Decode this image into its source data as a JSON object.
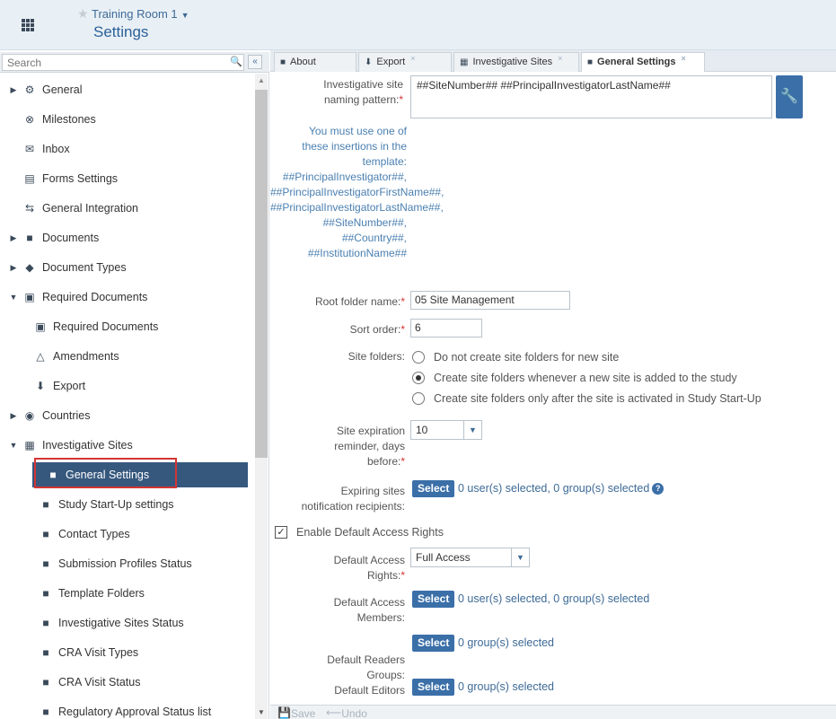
{
  "header": {
    "room_name": "Training Room 1",
    "page_title": "Settings"
  },
  "sidebar": {
    "search_placeholder": "Search",
    "items": [
      {
        "label": "General",
        "icon": "gears-icon",
        "arrow": "▶"
      },
      {
        "label": "Milestones",
        "icon": "milestones-icon",
        "arrow": ""
      },
      {
        "label": "Inbox",
        "icon": "inbox-icon",
        "arrow": ""
      },
      {
        "label": "Forms Settings",
        "icon": "form-icon",
        "arrow": ""
      },
      {
        "label": "General Integration",
        "icon": "integration-icon",
        "arrow": ""
      },
      {
        "label": "Documents",
        "icon": "document-icon",
        "arrow": "▶"
      },
      {
        "label": "Document Types",
        "icon": "tag-icon",
        "arrow": "▶"
      },
      {
        "label": "Required Documents",
        "icon": "clipboard-icon",
        "arrow": "▼"
      },
      {
        "label": "Required Documents",
        "icon": "clipboard-icon",
        "arrow": ""
      },
      {
        "label": "Amendments",
        "icon": "flask-icon",
        "arrow": ""
      },
      {
        "label": "Export",
        "icon": "download-icon",
        "arrow": ""
      },
      {
        "label": "Countries",
        "icon": "globe-icon",
        "arrow": "▶"
      },
      {
        "label": "Investigative Sites",
        "icon": "sites-icon",
        "arrow": "▼"
      },
      {
        "label": "General Settings",
        "icon": "document-icon",
        "arrow": "",
        "selected": true
      },
      {
        "label": "Study Start-Up settings",
        "icon": "document-icon",
        "arrow": ""
      },
      {
        "label": "Contact Types",
        "icon": "document-icon",
        "arrow": ""
      },
      {
        "label": "Submission Profiles Status",
        "icon": "document-icon",
        "arrow": ""
      },
      {
        "label": "Template Folders",
        "icon": "document-icon",
        "arrow": ""
      },
      {
        "label": "Investigative Sites Status",
        "icon": "document-icon",
        "arrow": ""
      },
      {
        "label": "CRA Visit Types",
        "icon": "document-icon",
        "arrow": ""
      },
      {
        "label": "CRA Visit Status",
        "icon": "document-icon",
        "arrow": ""
      },
      {
        "label": "Regulatory Approval Status list",
        "icon": "document-icon",
        "arrow": ""
      }
    ]
  },
  "tabs": [
    {
      "label": "About",
      "icon": "document-icon"
    },
    {
      "label": "Export",
      "icon": "download-icon"
    },
    {
      "label": "Investigative Sites",
      "icon": "sites-icon"
    },
    {
      "label": "General Settings",
      "icon": "document-icon",
      "active": true
    }
  ],
  "form": {
    "naming_pattern_label_1": "Investigative site",
    "naming_pattern_label_2": "naming pattern:",
    "naming_pattern_value": "##SiteNumber## ##PrincipalInvestigatorLastName##",
    "hint_lines": [
      "You must use one of",
      "these insertions in the",
      "template:",
      "##PrincipalInvestigator##,",
      "##PrincipalInvestigatorFirstName##,",
      "##PrincipalInvestigatorLastName##,",
      "##SiteNumber##,",
      "##Country##,",
      "##InstitutionName##"
    ],
    "root_folder_label": "Root folder name:",
    "root_folder_value": "05 Site Management",
    "sort_order_label": "Sort order:",
    "sort_order_value": "6",
    "site_folders_label": "Site folders:",
    "site_folder_options": [
      {
        "label": "Do not create site folders for new site",
        "selected": false
      },
      {
        "label": "Create site folders whenever a new site is added to the study",
        "selected": true
      },
      {
        "label": "Create site folders only after the site is activated in Study Start-Up",
        "selected": false
      }
    ],
    "expiration_label_1": "Site expiration",
    "expiration_label_2": "reminder, days",
    "expiration_label_3": "before:",
    "expiration_value": "10",
    "expiring_label_1": "Expiring sites",
    "expiring_label_2": "notification recipients:",
    "expiring_selection": "0 user(s) selected, 0 group(s) selected",
    "select_label": "Select",
    "enable_rights_label": "Enable Default Access Rights",
    "enable_rights_checked": true,
    "access_rights_label_1": "Default Access",
    "access_rights_label_2": "Rights:",
    "access_rights_value": "Full Access",
    "access_members_label_1": "Default Access",
    "access_members_label_2": "Members:",
    "access_members_selection": "0 user(s) selected, 0 group(s) selected",
    "readers_label_1": "Default Readers",
    "readers_label_2": "Groups:",
    "readers_selection": "0 group(s) selected",
    "editors_label_1": "Default Editors",
    "editors_selection": "0 group(s) selected"
  },
  "bottom": {
    "save_label": "Save",
    "undo_label": "Undo"
  },
  "colors": {
    "accent": "#3b6fa8",
    "selected_row": "#36587d",
    "highlight_border": "#d43434"
  }
}
